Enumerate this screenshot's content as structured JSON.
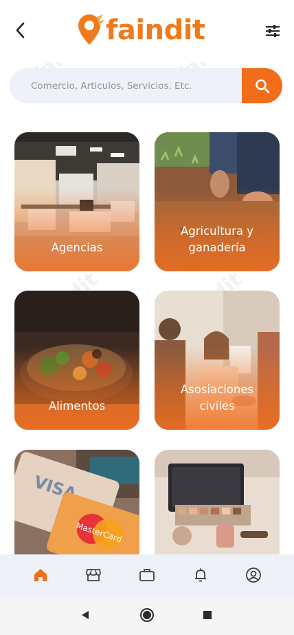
{
  "header": {
    "logo_text": "faindit",
    "back_icon": "chevron-left-icon",
    "filter_icon": "sliders-icon"
  },
  "search": {
    "placeholder": "Comercio, Articulos, Servicios, Etc.",
    "value": "",
    "button_icon": "search-icon"
  },
  "categories": [
    {
      "label_lines": [
        "Agencias"
      ]
    },
    {
      "label_lines": [
        "Agricultura y",
        "ganadería"
      ]
    },
    {
      "label_lines": [
        "Alimentos"
      ]
    },
    {
      "label_lines": [
        "Asosiaciones",
        "civiles"
      ]
    },
    {
      "label_lines": [
        ""
      ]
    },
    {
      "label_lines": [
        ""
      ]
    }
  ],
  "card_images": {
    "row3_left_text_1": "VISA",
    "row3_left_text_2": "MasterCard"
  },
  "bottom_nav": {
    "items": [
      "home-icon",
      "store-icon",
      "briefcase-icon",
      "bell-icon",
      "user-circle-icon"
    ],
    "active": 0
  },
  "system_nav": [
    "back-triangle-icon",
    "home-circle-icon",
    "recents-square-icon"
  ],
  "colors": {
    "accent": "#f26d1a",
    "search_bg": "#eef1f7",
    "nav_bg": "#eef1f7",
    "icon_dark": "#3a3f4b"
  }
}
